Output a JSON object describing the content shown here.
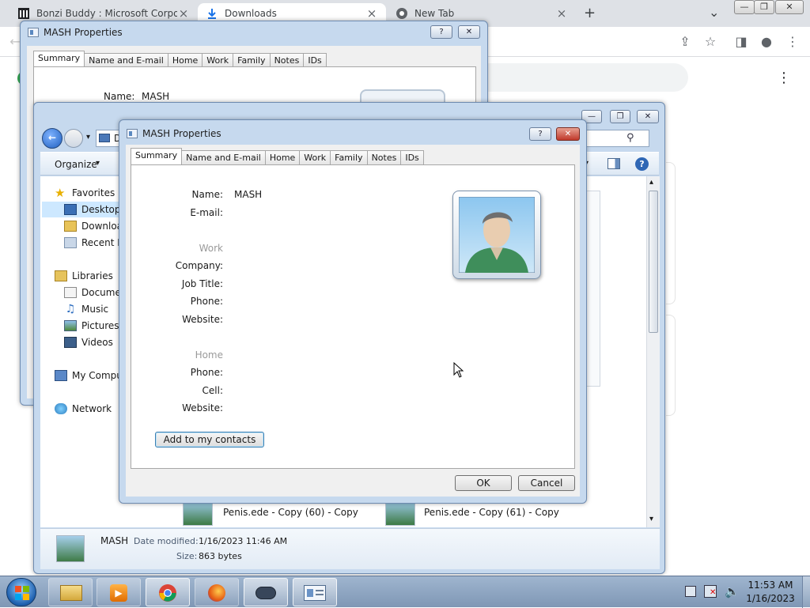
{
  "browser": {
    "tabs": [
      {
        "title": "Bonzi Buddy : Microsoft Corporat",
        "icon": "library-icon"
      },
      {
        "title": "Downloads",
        "icon": "download-icon"
      },
      {
        "title": "New Tab",
        "icon": "chrome-icon"
      }
    ],
    "new_tab_glyph": "+",
    "close_glyph": "×",
    "tab_menu_glyph": "⌄",
    "toolbar_glyphs": {
      "share": "⇪",
      "star": "☆",
      "sidepanel": "◨",
      "profile": "●",
      "menu": "⋮",
      "back": "←"
    },
    "window_glyphs": {
      "minimize": "—",
      "restore": "❐",
      "close": "✕"
    },
    "page_menu_glyph": "⋮"
  },
  "back_dialog": {
    "title": "MASH Properties",
    "help": "?",
    "close": "✕",
    "tabs": [
      "Summary",
      "Name and E-mail",
      "Home",
      "Work",
      "Family",
      "Notes",
      "IDs"
    ],
    "name_label": "Name:",
    "name_value": "MASH"
  },
  "explorer": {
    "address_prefix": "D",
    "organize": "Organize",
    "caret": "▾",
    "search_glyph": "⚲",
    "help_glyph": "?",
    "nav": [
      {
        "label": "Favorites"
      },
      {
        "label": "Desktop"
      },
      {
        "label": "Downloa"
      },
      {
        "label": "Recent Pl"
      },
      {
        "label": "Libraries"
      },
      {
        "label": "Documen"
      },
      {
        "label": "Music"
      },
      {
        "label": "Pictures"
      },
      {
        "label": "Videos"
      },
      {
        "label": "My Compu"
      },
      {
        "label": "Network"
      }
    ],
    "files": [
      {
        "name": "Penis.ede - Copy (60) - Copy"
      },
      {
        "name": "Penis.ede - Copy (61) - Copy"
      }
    ],
    "details": {
      "name": "MASH",
      "date_label": "Date modified:",
      "date_value": "1/16/2023 11:46 AM",
      "size_label": "Size:",
      "size_value": "863 bytes"
    },
    "scroll_up": "▴",
    "scroll_down": "▾"
  },
  "front_dialog": {
    "title": "MASH Properties",
    "help": "?",
    "close": "✕",
    "tabs": [
      "Summary",
      "Name and E-mail",
      "Home",
      "Work",
      "Family",
      "Notes",
      "IDs"
    ],
    "fields": {
      "name_label": "Name:",
      "name_value": "MASH",
      "email_label": "E-mail:",
      "work_header": "Work",
      "company_label": "Company:",
      "jobtitle_label": "Job Title:",
      "work_phone_label": "Phone:",
      "work_website_label": "Website:",
      "home_header": "Home",
      "home_phone_label": "Phone:",
      "cell_label": "Cell:",
      "home_website_label": "Website:"
    },
    "add_button": "Add to my contacts",
    "ok_button": "OK",
    "cancel_button": "Cancel"
  },
  "taskbar": {
    "apps": [
      {
        "name": "explorer",
        "icon": "folder-icon"
      },
      {
        "name": "media",
        "icon": "media-player-icon"
      },
      {
        "name": "chrome",
        "icon": "chrome-icon"
      },
      {
        "name": "firefox",
        "icon": "firefox-icon"
      },
      {
        "name": "app",
        "icon": "gamepad-icon"
      },
      {
        "name": "contact",
        "icon": "contact-card-icon"
      }
    ],
    "clock_time": "11:53 AM",
    "clock_date": "1/16/2023"
  },
  "colors": {
    "chrome_tabstrip": "#dee1e6",
    "win7_frame": "#c6d9ee",
    "selection": "#cde8ff",
    "taskbar": "#8aa3c2"
  }
}
